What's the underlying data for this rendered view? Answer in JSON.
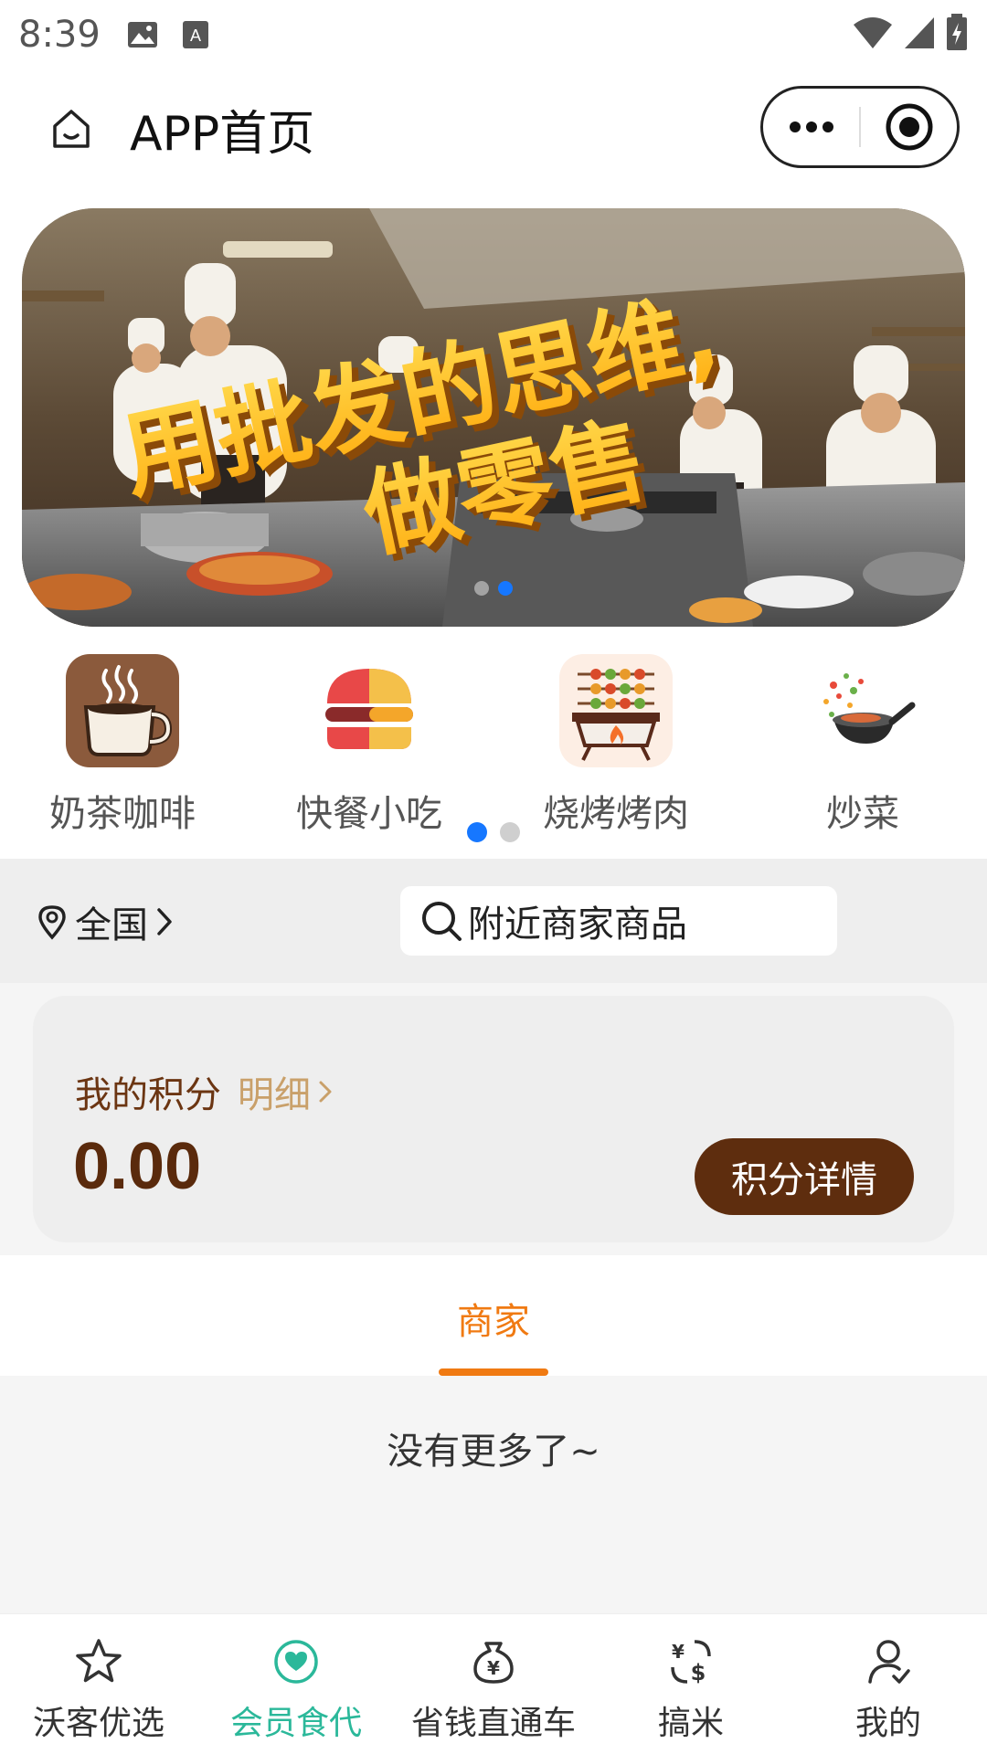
{
  "status_bar": {
    "time": "8:39"
  },
  "header": {
    "title": "APP首页"
  },
  "banner": {
    "headline_line1": "用批发的思维,",
    "headline_line2": "做零售"
  },
  "categories": [
    {
      "label": "奶茶咖啡",
      "icon": "coffee-cup-icon"
    },
    {
      "label": "快餐小吃",
      "icon": "burger-icon"
    },
    {
      "label": "烧烤烤肉",
      "icon": "bbq-grill-icon"
    },
    {
      "label": "炒菜",
      "icon": "wok-icon"
    }
  ],
  "location": {
    "label": "全国"
  },
  "search": {
    "placeholder": "附近商家商品"
  },
  "points": {
    "title": "我的积分",
    "detail_link": "明细",
    "value": "0.00",
    "button": "积分详情"
  },
  "tabs": {
    "merchant": "商家"
  },
  "list": {
    "end_text": "没有更多了~"
  },
  "bottom_nav": [
    {
      "label": "沃客优选",
      "icon": "star-icon"
    },
    {
      "label": "会员食代",
      "icon": "heart-icon",
      "active": true
    },
    {
      "label": "省钱直通车",
      "icon": "money-bag-icon"
    },
    {
      "label": "搞米",
      "icon": "yen-dollar-icon"
    },
    {
      "label": "我的",
      "icon": "user-icon"
    }
  ],
  "colors": {
    "accent_orange": "#f07a12",
    "points_brown": "#5e2d0e",
    "active_green": "#2bb89a",
    "indicator_blue": "#1677ff"
  }
}
